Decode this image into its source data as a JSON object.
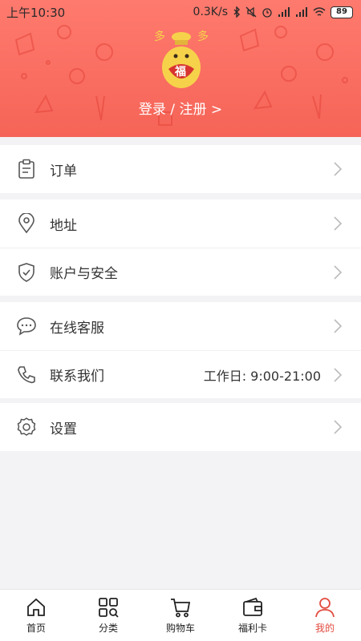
{
  "statusbar": {
    "time": "上午10:30",
    "speed": "0.3K/s",
    "battery": "89"
  },
  "header": {
    "login_text": "登录 / 注册 >",
    "mascot_char": "福",
    "mascot_top_text": "多 多"
  },
  "menu": {
    "orders": {
      "label": "订单",
      "icon": "clipboard-icon"
    },
    "address": {
      "label": "地址",
      "icon": "location-pin-icon"
    },
    "security": {
      "label": "账户与安全",
      "icon": "shield-check-icon"
    },
    "service": {
      "label": "在线客服",
      "icon": "chat-bubble-icon"
    },
    "contact": {
      "label": "联系我们",
      "icon": "phone-icon",
      "extra": "工作日: 9:00-21:00"
    },
    "settings": {
      "label": "设置",
      "icon": "gear-icon"
    }
  },
  "tabbar": {
    "items": [
      {
        "label": "首页",
        "icon": "home-icon"
      },
      {
        "label": "分类",
        "icon": "category-grid-icon"
      },
      {
        "label": "购物车",
        "icon": "cart-icon"
      },
      {
        "label": "福利卡",
        "icon": "wallet-card-icon"
      },
      {
        "label": "我的",
        "icon": "user-icon"
      }
    ],
    "active_index": 4
  },
  "colors": {
    "header_top": "#ff7a6e",
    "header_bottom": "#f56457",
    "accent": "#e24b3f",
    "background": "#f3f2f5"
  }
}
